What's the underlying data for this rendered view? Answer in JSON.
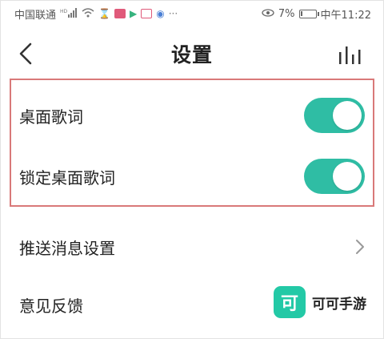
{
  "status_bar": {
    "carrier": "中国联通",
    "signal_label": "HD",
    "battery_percent": "7%",
    "time": "中午11:22",
    "battery_level": 0.07
  },
  "header": {
    "title": "设置",
    "back_icon": "chevron-left-icon",
    "equalizer_icon": "equalizer-icon"
  },
  "settings": {
    "desktop_lyrics": {
      "label": "桌面歌词",
      "enabled": true
    },
    "lock_desktop_lyrics": {
      "label": "锁定桌面歌词",
      "enabled": true
    },
    "push_settings": {
      "label": "推送消息设置"
    },
    "feedback": {
      "label": "意见反馈"
    }
  },
  "watermark": {
    "logo_text": "可",
    "text": "可可手游"
  },
  "colors": {
    "accent": "#2fbda4",
    "highlight_border": "#d97979",
    "wm_logo": "#23c9a6"
  }
}
